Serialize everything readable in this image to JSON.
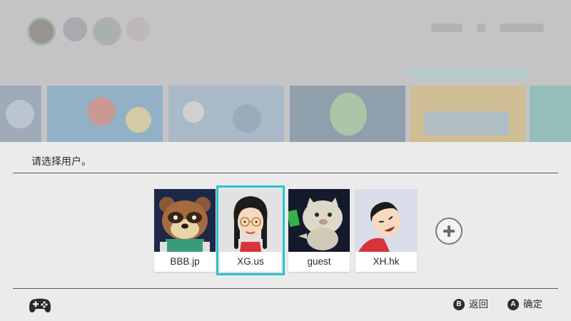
{
  "dialog": {
    "prompt": "请选择用户。"
  },
  "users": [
    {
      "name": "BBB.jp",
      "avatar": "raccoon-villager-avatar",
      "selected": false
    },
    {
      "name": "XG.us",
      "avatar": "mii-girl-glasses-avatar",
      "selected": true
    },
    {
      "name": "guest",
      "avatar": "cat-character-avatar",
      "selected": false
    },
    {
      "name": "XH.hk",
      "avatar": "mii-boy-avatar",
      "selected": false
    }
  ],
  "add_user": {
    "icon": "plus-icon"
  },
  "footer": {
    "controller_icon": "controller-icon",
    "back": {
      "button": "B",
      "label": "返回"
    },
    "confirm": {
      "button": "A",
      "label": "确定"
    }
  },
  "colors": {
    "selection": "#27c4c8",
    "panel": "#ebebeb",
    "background_dim": "#c2c2c4"
  }
}
